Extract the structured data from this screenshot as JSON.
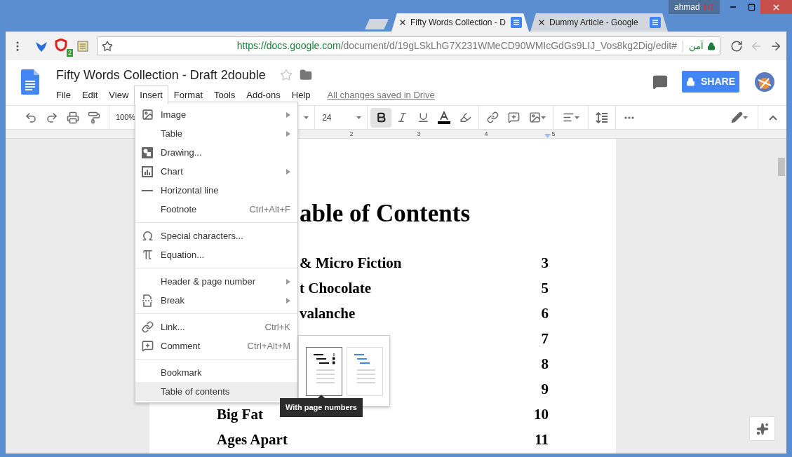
{
  "browser": {
    "user": "ahmad",
    "tabs": [
      {
        "title": "Fifty Words Collection - D",
        "selected": true
      },
      {
        "title": "Dummy Article - Google",
        "selected": false
      }
    ],
    "extension_badge": "2",
    "url_host": "https://docs.google.com",
    "url_path": "/document/d/19gLSkLhG7X231WMeCD90WMIcGdGs9LIJ_Vos8kg2Dig/edit#",
    "security_label": "آمن",
    "back_disabled": true
  },
  "docs": {
    "title": "Fifty Words Collection - Draft 2double",
    "menus": [
      {
        "label": "File",
        "selected": false
      },
      {
        "label": "Edit",
        "selected": false
      },
      {
        "label": "View",
        "selected": false
      },
      {
        "label": "Insert",
        "selected": true
      },
      {
        "label": "Format",
        "selected": false
      },
      {
        "label": "Tools",
        "selected": false
      },
      {
        "label": "Add-ons",
        "selected": false
      },
      {
        "label": "Help",
        "selected": false
      }
    ],
    "save_status": "All changes saved in Drive",
    "share_label": "SHARE"
  },
  "toolbar": {
    "zoom": "100%",
    "font_size": "24",
    "format_buttons": [
      {
        "kind": "bold",
        "on": true
      },
      {
        "kind": "italic",
        "on": false
      },
      {
        "kind": "underline",
        "on": false
      }
    ]
  },
  "ruler": {
    "labels": [
      "2",
      "3",
      "4",
      "5"
    ]
  },
  "document": {
    "heading": "able of Contents",
    "partly_covered_entries": [
      {
        "title": "& Micro Fiction",
        "page": "3"
      },
      {
        "title": "t Chocolate",
        "page": "5"
      },
      {
        "title": "valanche",
        "page": "6"
      },
      {
        "page": "7"
      },
      {
        "page": "8"
      },
      {
        "page": "9"
      }
    ],
    "entries": [
      {
        "title": "Big Fat",
        "page": "10"
      },
      {
        "title": "Ages Apart",
        "page": "11"
      }
    ]
  },
  "insert_menu": {
    "groups": [
      {
        "items": [
          {
            "label": "Image",
            "submenu": true,
            "selected": false
          },
          {
            "label": "Table",
            "submenu": true,
            "selected": false
          },
          {
            "label": "Drawing...",
            "submenu": false,
            "selected": false
          },
          {
            "label": "Chart",
            "submenu": true,
            "selected": false
          },
          {
            "label": "Horizontal line",
            "submenu": false,
            "selected": false
          },
          {
            "label": "Footnote",
            "shortcut": "Ctrl+Alt+F",
            "submenu": false,
            "selected": false
          }
        ]
      },
      {
        "items": [
          {
            "label": "Special characters...",
            "submenu": false,
            "selected": false
          },
          {
            "label": "Equation...",
            "submenu": false,
            "selected": false
          }
        ]
      },
      {
        "items": [
          {
            "label": "Header & page number",
            "submenu": true,
            "selected": false
          },
          {
            "label": "Break",
            "submenu": true,
            "selected": false
          }
        ]
      },
      {
        "items": [
          {
            "label": "Link...",
            "shortcut": "Ctrl+K",
            "submenu": false,
            "selected": false
          },
          {
            "label": "Comment",
            "shortcut": "Ctrl+Alt+M",
            "submenu": false,
            "selected": false
          }
        ]
      },
      {
        "items": [
          {
            "label": "Bookmark",
            "submenu": false,
            "selected": false
          },
          {
            "label": "Table of contents",
            "submenu": false,
            "selected": true
          }
        ]
      }
    ]
  },
  "toc_options": [
    {
      "kind": "numbered",
      "selected": true
    },
    {
      "kind": "linked",
      "selected": false
    }
  ],
  "tooltip": "With page numbers"
}
